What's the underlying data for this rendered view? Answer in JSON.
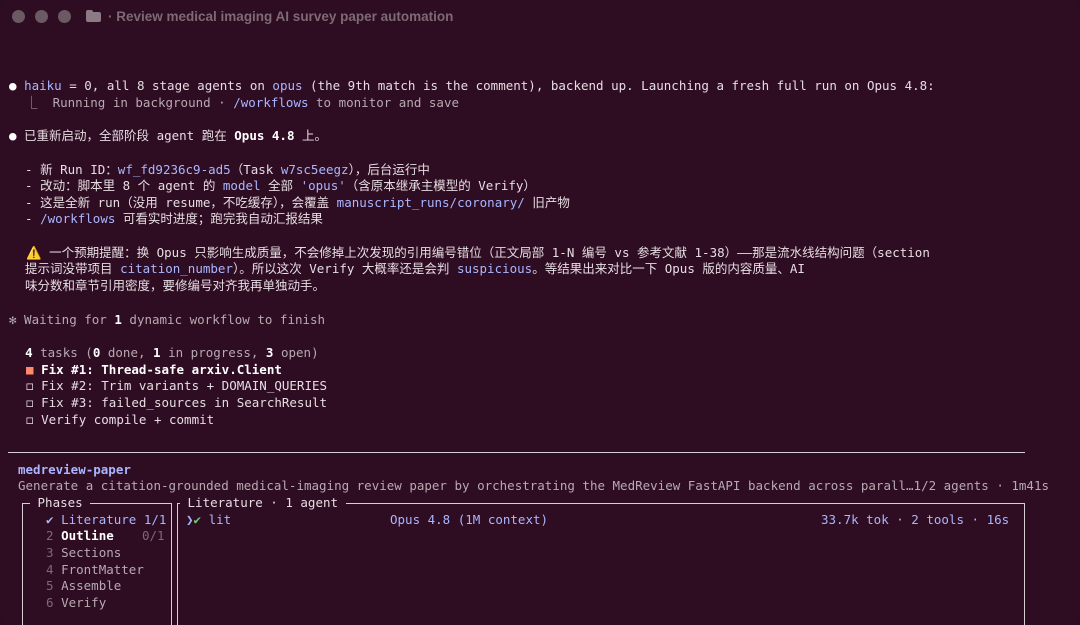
{
  "window": {
    "title": "Review medical imaging AI survey paper automation"
  },
  "transcript": {
    "line1": {
      "bullet": "●",
      "p1": "haiku",
      "p2": " = 0, all 8 stage agents on ",
      "p3": "opus",
      "p4": " (the 9th match is the comment), backend up. Launching a fresh full run on Opus 4.8:"
    },
    "line2": {
      "prefix": "  ⎿  ",
      "p1": "Running in background · ",
      "p2": "/workflows",
      "p3": " to monitor and save"
    },
    "line3": {
      "bullet": "●",
      "p1": " 已重新启动，全部阶段 agent 跑在 ",
      "p2": "Opus 4.8",
      "p3": " 上。"
    },
    "items": [
      {
        "p1": "  - 新 Run ID：",
        "p2": "wf_fd9236c9-ad5",
        "p3": "（Task ",
        "p4": "w7sc5eegz",
        "p5": "），后台运行中"
      },
      {
        "p1": "  - 改动：脚本里 8 个 agent 的 ",
        "p2": "model",
        "p3": " 全部 ",
        "p4": "'opus'",
        "p5": "（含原本继承主模型的 Verify）"
      },
      {
        "p1": "  - 这是全新 run（没用 resume，不吃缓存），会覆盖 ",
        "p2": "manuscript_runs/coronary/",
        "p3": " 旧产物"
      },
      {
        "p1": "  - ",
        "p2": "/workflows",
        "p3": " 可看实时进度；跑完我自动汇报结果"
      }
    ],
    "warning": {
      "icon": "⚠️",
      "p1": " 一个预期提醒：换 Opus 只影响生成质量，不会修掉上次发现的引用编号错位（正文局部 1-N 编号 vs 参考文献 1-38）——那是流水线结构问题（section",
      "p2a": "  提示词没带项目 ",
      "p2b": "citation_number",
      "p2c": "）。所以这次 Verify 大概率还是会判 ",
      "p2d": "suspicious",
      "p2e": "。等结果出来对比一下 Opus 版的内容质量、AI",
      "p3": "  味分数和章节引用密度，要修编号对齐我再单独动手。"
    },
    "waiting": {
      "p1": "✻ Waiting for ",
      "p2": "1",
      "p3": " dynamic workflow to finish"
    },
    "tasks_summary": {
      "p1": "  ",
      "p2": "4",
      "p3": " tasks (",
      "p4": "0",
      "p5": " done, ",
      "p6": "1",
      "p7": " in progress, ",
      "p8": "3",
      "p9": " open)"
    },
    "tasks": [
      {
        "marker": "■",
        "label": "Fix #1: Thread-safe arxiv.Client",
        "state": "in-progress"
      },
      {
        "marker": "◻",
        "label": "Fix #2: Trim variants + DOMAIN_QUERIES",
        "state": "open"
      },
      {
        "marker": "◻",
        "label": "Fix #3: failed_sources in SearchResult",
        "state": "open"
      },
      {
        "marker": "◻",
        "label": "Verify compile + commit",
        "state": "open"
      }
    ]
  },
  "workflow": {
    "name": "medreview-paper",
    "description": "Generate a citation-grounded medical-imaging review paper by orchestrating the MedReview FastAPI backend across parall…1/2 agents · 1m41s",
    "phases_title": " Phases ",
    "phases": [
      {
        "mark": "✔",
        "name": "Literature",
        "count": "1/1",
        "state": "done"
      },
      {
        "mark": "2",
        "name": "Outline",
        "count": "0/1",
        "state": "active"
      },
      {
        "mark": "3",
        "name": "Sections",
        "count": "",
        "state": "pending"
      },
      {
        "mark": "4",
        "name": "FrontMatter",
        "count": "",
        "state": "pending"
      },
      {
        "mark": "5",
        "name": "Assemble",
        "count": "",
        "state": "pending"
      },
      {
        "mark": "6",
        "name": "Verify",
        "count": "",
        "state": "pending"
      }
    ],
    "agents_title": " Literature · 1 agent ",
    "agent": {
      "chevron": "❯",
      "check": "✔",
      "name": "lit",
      "model": "Opus 4.8 (1M context)",
      "stats": "33.7k tok · 2 tools · 16s"
    }
  }
}
